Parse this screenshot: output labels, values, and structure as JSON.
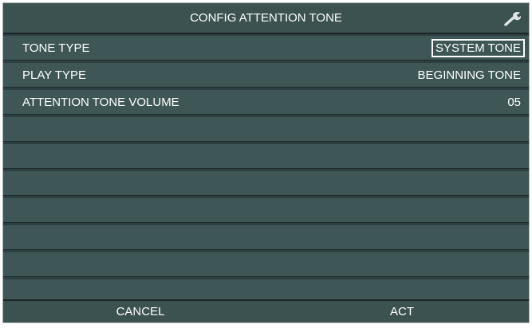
{
  "header": {
    "title": "CONFIG ATTENTION TONE",
    "icon": "wrench-icon"
  },
  "rows": [
    {
      "label": "TONE TYPE",
      "value": "SYSTEM TONE",
      "selected": true
    },
    {
      "label": "PLAY TYPE",
      "value": "BEGINNING TONE",
      "selected": false
    },
    {
      "label": "ATTENTION TONE VOLUME",
      "value": "05",
      "selected": false
    }
  ],
  "footer": {
    "cancel_label": "CANCEL",
    "act_label": "ACT"
  },
  "colors": {
    "background": "#2d3f40",
    "row": "#3e5756",
    "text": "#ffffff"
  }
}
